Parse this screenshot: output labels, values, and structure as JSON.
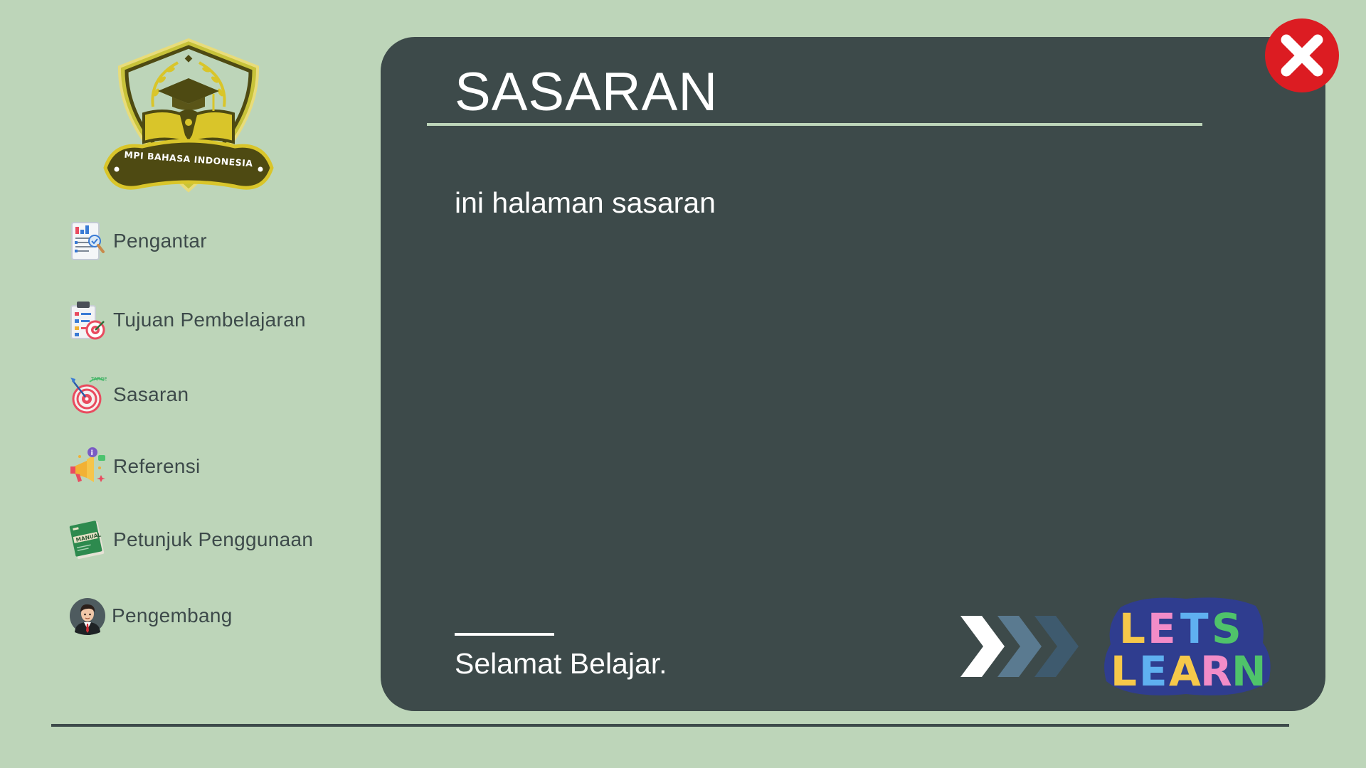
{
  "logo": {
    "text": "MPI BAHASA INDONESIA",
    "icon": "graduation-cap-book-pen-emblem",
    "colors": {
      "gold": "#d9c52a",
      "olive": "#4e4a12",
      "outline": "#e8dc7a"
    }
  },
  "sidebar": {
    "items": [
      {
        "label": "Pengantar",
        "icon": "report-document-icon"
      },
      {
        "label": "Tujuan Pembelajaran",
        "icon": "goal-checklist-icon"
      },
      {
        "label": "Sasaran",
        "icon": "target-dart-icon"
      },
      {
        "label": "Referensi",
        "icon": "megaphone-info-icon"
      },
      {
        "label": "Petunjuk Penggunaan",
        "icon": "manual-book-icon"
      },
      {
        "label": "Pengembang",
        "icon": "developer-avatar-icon"
      }
    ]
  },
  "main": {
    "title": "SASARAN",
    "body": "ini halaman sasaran",
    "footer": "Selamat Belajar.",
    "next_icon": "triple-chevron-right-icon",
    "sticker": {
      "line1": "LETS",
      "line2": "LEARN"
    }
  },
  "close_icon": "close-x-icon",
  "colors": {
    "background": "#bdd5b9",
    "panel": "#3d4a4a",
    "text_dark": "#3d4a4a",
    "text_light": "#ffffff",
    "close_red": "#dc1c22"
  }
}
